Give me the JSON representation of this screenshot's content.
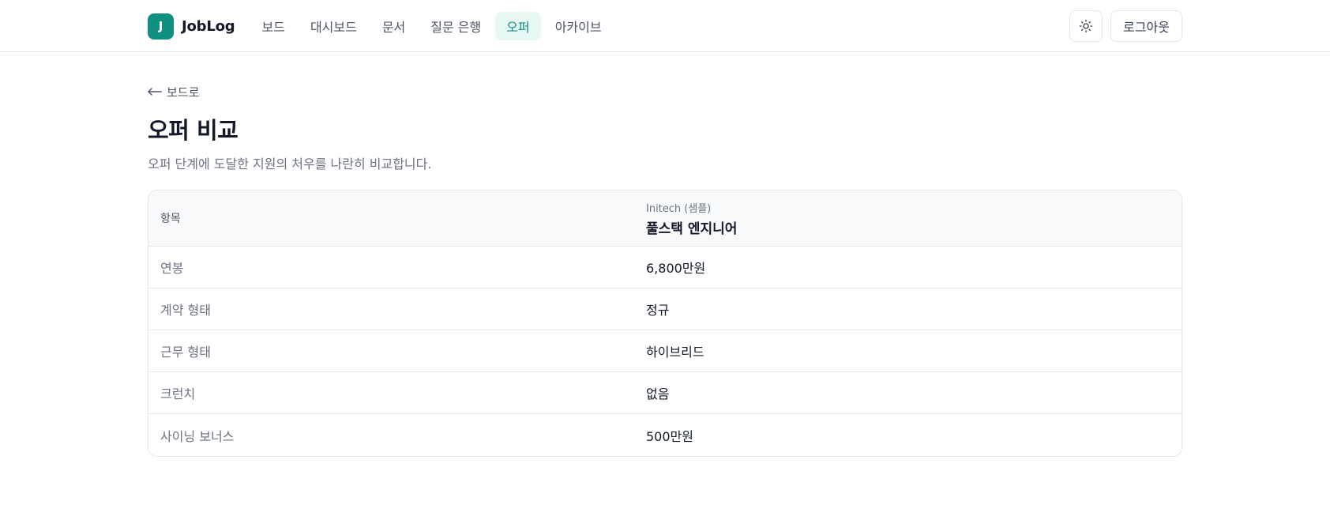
{
  "header": {
    "logo_letter": "J",
    "brand": "JobLog",
    "nav": [
      {
        "label": "보드",
        "active": false
      },
      {
        "label": "대시보드",
        "active": false
      },
      {
        "label": "문서",
        "active": false
      },
      {
        "label": "질문 은행",
        "active": false
      },
      {
        "label": "오퍼",
        "active": true
      },
      {
        "label": "아카이브",
        "active": false
      }
    ],
    "theme_icon": "sun-icon",
    "logout_label": "로그아웃"
  },
  "page": {
    "back_label": "보드로",
    "title": "오퍼 비교",
    "description": "오퍼 단계에 도달한 지원의 처우를 나란히 비교합니다."
  },
  "table": {
    "header_label": "항목",
    "offer": {
      "company": "Initech (샘플)",
      "position": "풀스택 엔지니어"
    },
    "rows": [
      {
        "label": "연봉",
        "value": "6,800만원"
      },
      {
        "label": "계약 형태",
        "value": "정규"
      },
      {
        "label": "근무 형태",
        "value": "하이브리드"
      },
      {
        "label": "크런치",
        "value": "없음"
      },
      {
        "label": "사이닝 보너스",
        "value": "500만원"
      }
    ]
  },
  "colors": {
    "accent": "#0f8f80",
    "accent_bg": "#e6f7f4",
    "border": "#e5e7eb"
  }
}
